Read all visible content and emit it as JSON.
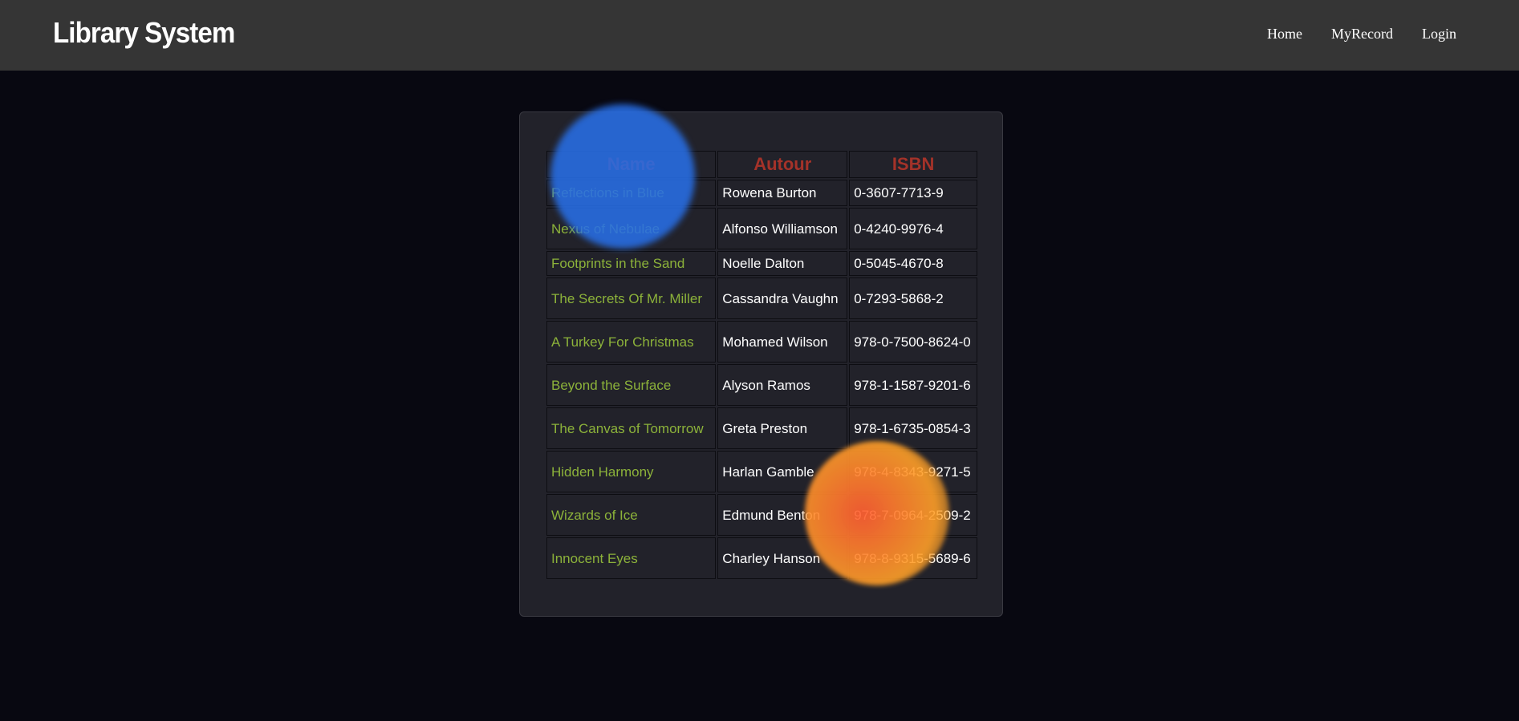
{
  "navbar": {
    "brand": "Library System",
    "links": [
      "Home",
      "MyRecord",
      "Login"
    ]
  },
  "table": {
    "headers": [
      "Name",
      "Autour",
      "ISBN"
    ],
    "rows": [
      {
        "name": "Reflections in Blue",
        "author": "Rowena Burton",
        "isbn": "0-3607-7713-9"
      },
      {
        "name": "Nexus of Nebulae",
        "author": "Alfonso Williamson",
        "isbn": "0-4240-9976-4"
      },
      {
        "name": "Footprints in the Sand",
        "author": "Noelle Dalton",
        "isbn": "0-5045-4670-8"
      },
      {
        "name": "The Secrets Of Mr. Miller",
        "author": "Cassandra Vaughn",
        "isbn": "0-7293-5868-2"
      },
      {
        "name": "A Turkey For Christmas",
        "author": "Mohamed Wilson",
        "isbn": "978-0-7500-8624-0"
      },
      {
        "name": "Beyond the Surface",
        "author": "Alyson Ramos",
        "isbn": "978-1-1587-9201-6"
      },
      {
        "name": "The Canvas of Tomorrow",
        "author": "Greta Preston",
        "isbn": "978-1-6735-0854-3"
      },
      {
        "name": "Hidden Harmony",
        "author": "Harlan Gamble",
        "isbn": "978-4-8343-9271-5"
      },
      {
        "name": "Wizards of Ice",
        "author": "Edmund Benton",
        "isbn": "978-7-0964-2509-2"
      },
      {
        "name": "Innocent Eyes",
        "author": "Charley Hanson",
        "isbn": "978-8-9315-5689-6"
      }
    ]
  },
  "colors": {
    "navbar_bg": "#353535",
    "page_bg": "#080811",
    "header_text": "#a43229",
    "name_text": "#8cb23a"
  }
}
